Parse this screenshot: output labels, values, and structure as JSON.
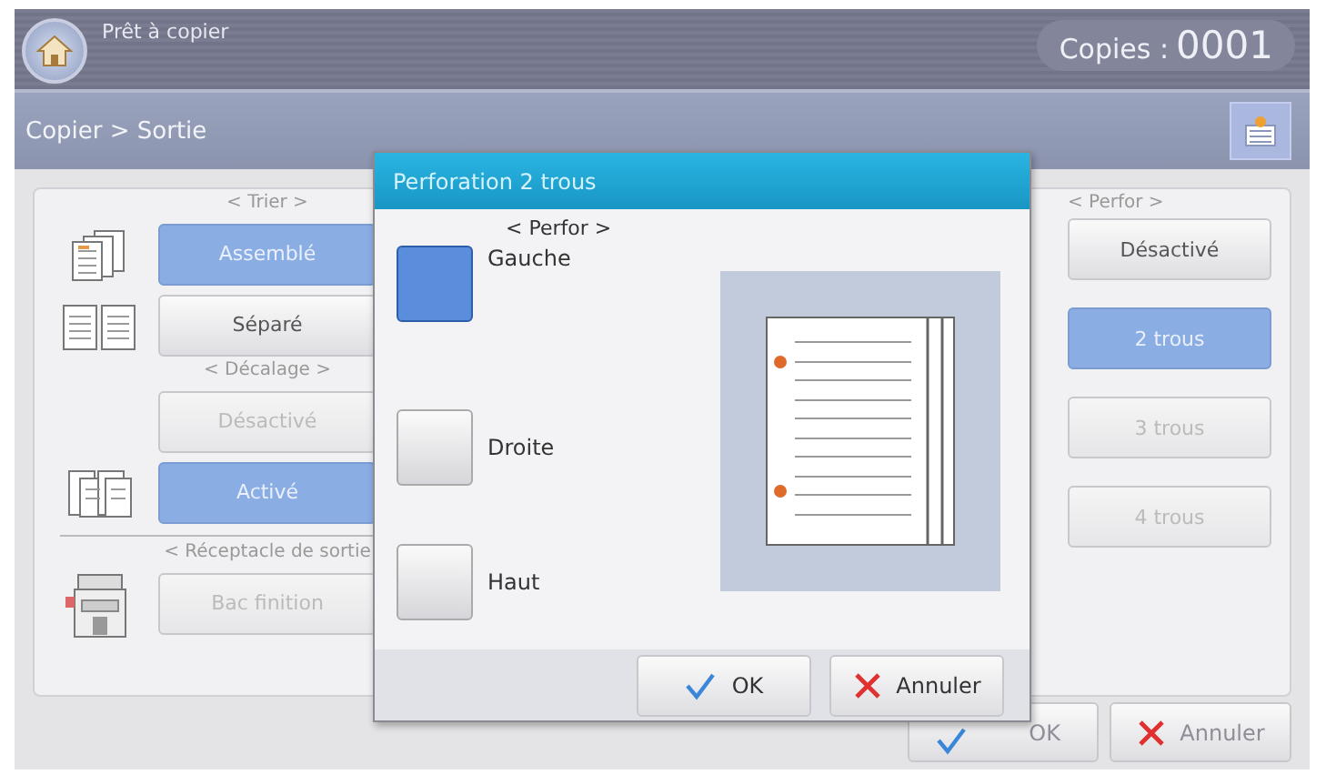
{
  "header": {
    "status": "Prêt à copier",
    "copies_label": "Copies :",
    "copies_value": "0001"
  },
  "breadcrumb": "Copier > Sortie",
  "left_groups": [
    {
      "title": "< Trier >",
      "options": [
        {
          "label": "Assemblé",
          "kind": "collated",
          "selected": true,
          "disabled": false
        },
        {
          "label": "Séparé",
          "kind": "uncollated",
          "selected": false,
          "disabled": false
        }
      ]
    },
    {
      "title": "< Décalage >",
      "options": [
        {
          "label": "Désactivé",
          "kind": "plain",
          "selected": false,
          "disabled": true
        },
        {
          "label": "Activé",
          "kind": "offset",
          "selected": true,
          "disabled": false
        }
      ]
    },
    {
      "title": "< Réceptacle de sortie",
      "options": [
        {
          "label": "Bac finition",
          "kind": "finisher",
          "selected": false,
          "disabled": true
        }
      ]
    }
  ],
  "right_group": {
    "title": "< Perfor >",
    "options": [
      {
        "label": "Désactivé",
        "selected": false,
        "disabled": false
      },
      {
        "label": "2 trous",
        "selected": true,
        "disabled": false
      },
      {
        "label": "3 trous",
        "selected": false,
        "disabled": true
      },
      {
        "label": "4 trous",
        "selected": false,
        "disabled": true
      }
    ]
  },
  "footer_buttons": [
    {
      "label": "OK",
      "kind": "confirm",
      "disabled": true
    },
    {
      "label": "Annuler",
      "kind": "cancel",
      "disabled": true
    }
  ],
  "dialog": {
    "title": "Perforation 2 trous",
    "subtitle": "< Perfor >",
    "options": [
      {
        "label": "Gauche",
        "selected": true
      },
      {
        "label": "Droite",
        "selected": false
      },
      {
        "label": "Haut",
        "selected": false
      }
    ],
    "buttons": [
      {
        "label": "OK",
        "kind": "confirm"
      },
      {
        "label": "Annuler",
        "kind": "cancel"
      }
    ]
  }
}
